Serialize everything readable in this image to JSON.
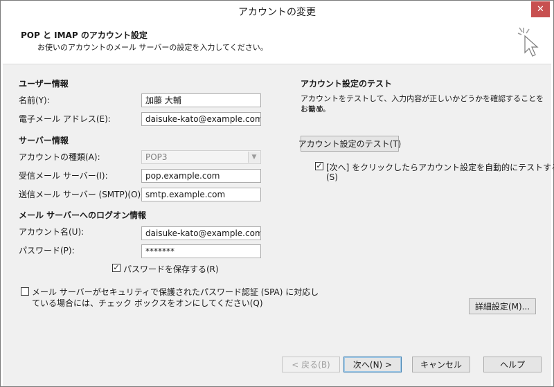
{
  "window": {
    "title": "アカウントの変更",
    "close_glyph": "✕"
  },
  "header": {
    "title": "POP と IMAP のアカウント設定",
    "subtitle": "お使いのアカウントのメール サーバーの設定を入力してください。"
  },
  "user_info": {
    "heading": "ユーザー情報",
    "name_label": "名前(Y):",
    "name_value": "加藤 大輔",
    "email_label": "電子メール アドレス(E):",
    "email_value": "daisuke-kato@example.com"
  },
  "server_info": {
    "heading": "サーバー情報",
    "account_type_label": "アカウントの種類(A):",
    "account_type_value": "POP3",
    "incoming_label": "受信メール サーバー(I):",
    "incoming_value": "pop.example.com",
    "outgoing_label": "送信メール サーバー (SMTP)(O):",
    "outgoing_value": "smtp.example.com"
  },
  "logon_info": {
    "heading": "メール サーバーへのログオン情報",
    "account_name_label": "アカウント名(U):",
    "account_name_value": "daisuke-kato@example.com",
    "password_label": "パスワード(P):",
    "password_value": "*******",
    "save_password_label": "パスワードを保存する(R)",
    "save_password_checked": true,
    "spa_line1": "メール サーバーがセキュリティで保護されたパスワード認証 (SPA) に対応し",
    "spa_line2": "ている場合には、チェック ボックスをオンにしてください(Q)",
    "spa_checked": false
  },
  "test": {
    "heading": "アカウント設定のテスト",
    "desc_line1": "アカウントをテストして、入力内容が正しいかどうかを確認することをお勧め",
    "desc_line2": "します。",
    "button_label": "アカウント設定のテスト(T)",
    "auto_test_line1": "[次へ] をクリックしたらアカウント設定を自動的にテストする",
    "auto_test_line2": "(S)",
    "auto_test_checked": true
  },
  "advanced_button": "詳細設定(M)...",
  "footer": {
    "back": "< 戻る(B)",
    "next": "次へ(N) >",
    "cancel": "キャンセル",
    "help": "ヘルプ"
  },
  "check_glyph": "✓"
}
